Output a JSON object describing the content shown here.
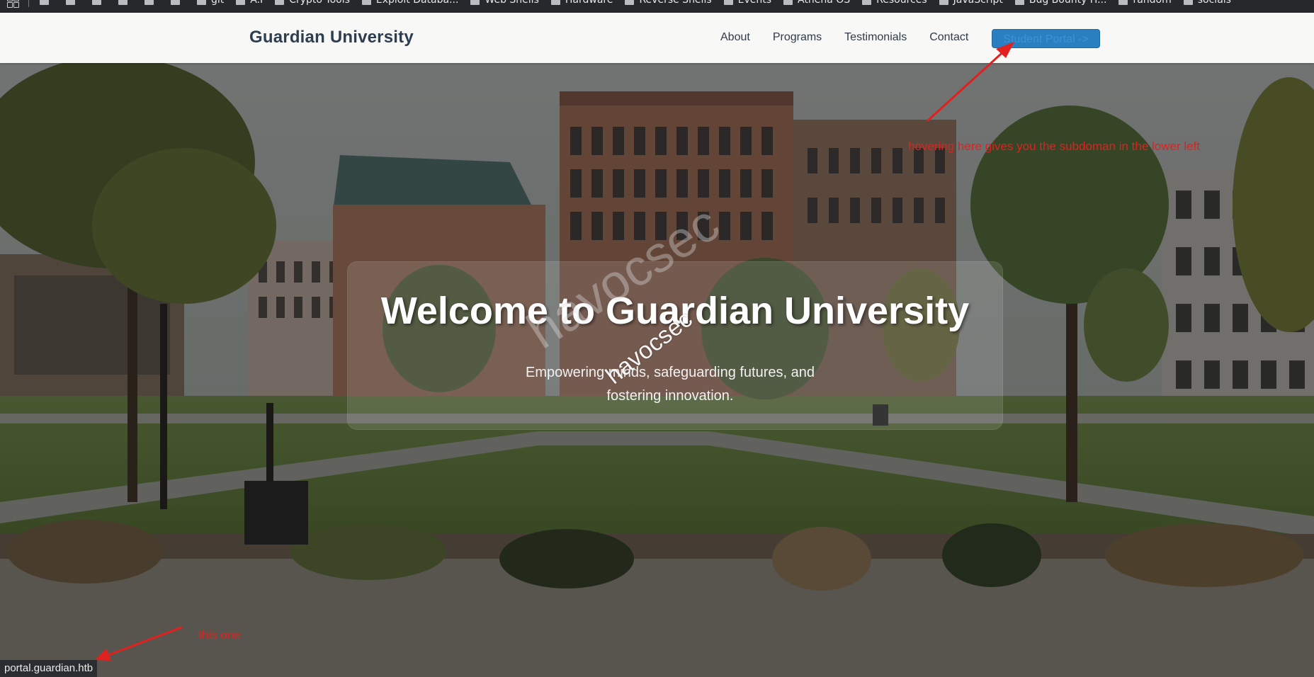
{
  "bookmarks_bar": {
    "items": [
      {
        "label": ""
      },
      {
        "label": ""
      },
      {
        "label": ""
      },
      {
        "label": ""
      },
      {
        "label": ""
      },
      {
        "label": ""
      },
      {
        "label": "git"
      },
      {
        "label": "A.I"
      },
      {
        "label": "Crypto Tools"
      },
      {
        "label": "Exploit Databa..."
      },
      {
        "label": "Web Shells"
      },
      {
        "label": "Hardware"
      },
      {
        "label": "Reverse Shells"
      },
      {
        "label": "Events"
      },
      {
        "label": "Athena OS"
      },
      {
        "label": "Resources"
      },
      {
        "label": "JavaScript"
      },
      {
        "label": "Bug Bounty H..."
      },
      {
        "label": "random"
      },
      {
        "label": "socials"
      }
    ]
  },
  "header": {
    "logo": "Guardian University",
    "nav": [
      "About",
      "Programs",
      "Testimonials",
      "Contact"
    ],
    "portal_button": "Student Portal ->"
  },
  "hero": {
    "title": "Welcome to Guardian University",
    "subtitle": "Empowering minds, safeguarding futures, and fostering innovation."
  },
  "watermarks": {
    "large": "havocsec",
    "small": "havocsec"
  },
  "annotations": {
    "hover_note": "hovering here gives you the subdoman in the lower left",
    "this_one": "this one"
  },
  "status_bar": {
    "url": "portal.guardian.htb"
  },
  "colors": {
    "accent": "#2a7fc1",
    "annotation": "#e0211f",
    "logo": "#2c3e50"
  }
}
